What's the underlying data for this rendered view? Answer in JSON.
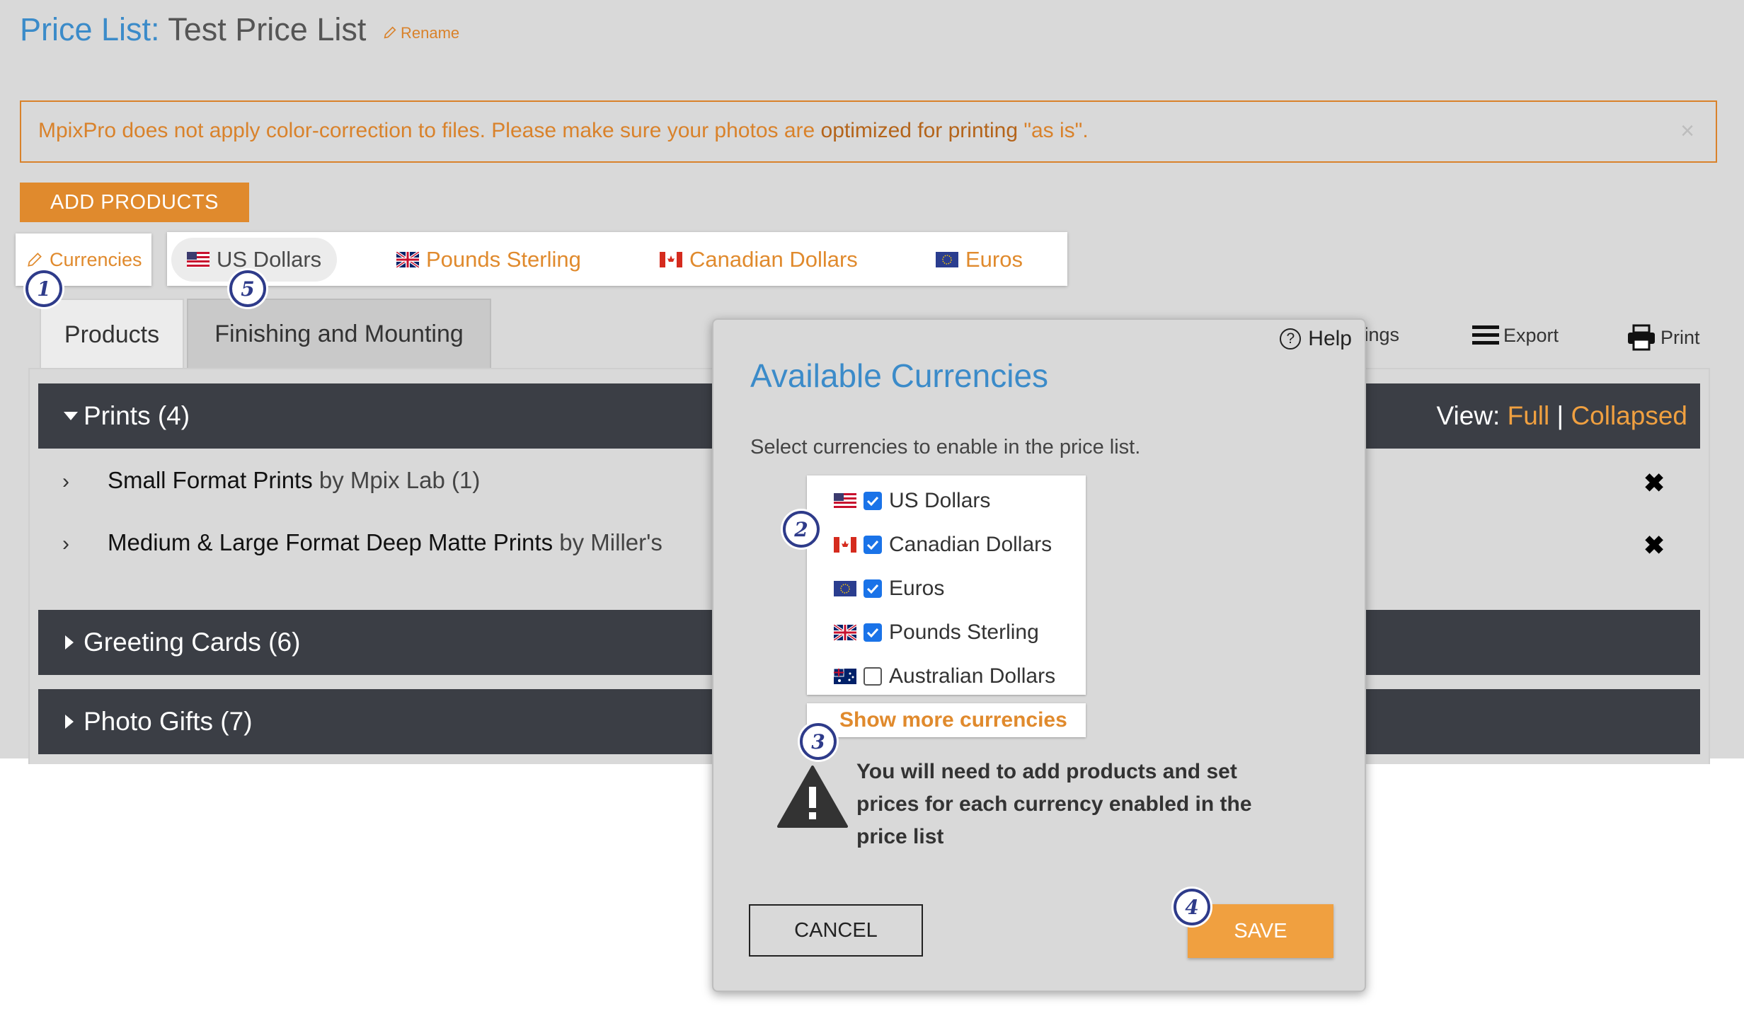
{
  "header": {
    "title_label": "Price List:",
    "title_name": "Test Price List",
    "rename_label": "Rename"
  },
  "notice": {
    "text_before": "MpixPro does not apply color-correction to files. Please make sure your photos are ",
    "link_text": "optimized for printing",
    "text_after": " \"as is\".",
    "close_icon": "×"
  },
  "actions": {
    "add_products": "ADD PRODUCTS"
  },
  "currency_bar": {
    "edit_label": "Currencies",
    "tabs": [
      {
        "label": "US Dollars",
        "flag": "us-flag-icon",
        "active": true
      },
      {
        "label": "Pounds Sterling",
        "flag": "uk-flag-icon",
        "active": false
      },
      {
        "label": "Canadian Dollars",
        "flag": "ca-flag-icon",
        "active": false
      },
      {
        "label": "Euros",
        "flag": "eu-flag-icon",
        "active": false
      }
    ]
  },
  "badges": [
    "1",
    "2",
    "3",
    "4",
    "5"
  ],
  "tabs": [
    {
      "label": "Products",
      "active": true
    },
    {
      "label": "Finishing and Mounting",
      "active": false
    }
  ],
  "toolbar": {
    "settings_partial": "tings",
    "export": "Export",
    "print": "Print"
  },
  "categories": [
    {
      "label": "Prints (4)",
      "expanded": true
    },
    {
      "label": "Greeting Cards (6)",
      "expanded": false
    },
    {
      "label": "Photo Gifts (7)",
      "expanded": false
    }
  ],
  "view": {
    "label": "View:",
    "full": "Full",
    "separator": "|",
    "collapsed": "Collapsed"
  },
  "products": [
    {
      "name": "Small Format Prints",
      "by": "by Mpix Lab (1)"
    },
    {
      "name": "Medium & Large Format Deep Matte Prints",
      "by": "by Miller's"
    }
  ],
  "modal": {
    "help": "Help",
    "title": "Available Currencies",
    "subtitle": "Select currencies to enable in the price list.",
    "currencies": [
      {
        "label": "US Dollars",
        "checked": true,
        "flag": "us-flag-icon"
      },
      {
        "label": "Canadian Dollars",
        "checked": true,
        "flag": "ca-flag-icon"
      },
      {
        "label": "Euros",
        "checked": true,
        "flag": "eu-flag-icon"
      },
      {
        "label": "Pounds Sterling",
        "checked": true,
        "flag": "uk-flag-icon"
      },
      {
        "label": "Australian Dollars",
        "checked": false,
        "flag": "au-flag-icon"
      }
    ],
    "show_more": "Show more currencies",
    "warning": "You will need to add products and set prices for each currency enabled in the price list",
    "cancel": "CANCEL",
    "save": "SAVE"
  },
  "colors": {
    "accent_orange": "#e08a2d",
    "title_blue": "#3b8bc9",
    "category_bar": "#3b3e45",
    "badge_navy": "#2e3b8a",
    "checkbox_blue": "#1a73e8"
  }
}
